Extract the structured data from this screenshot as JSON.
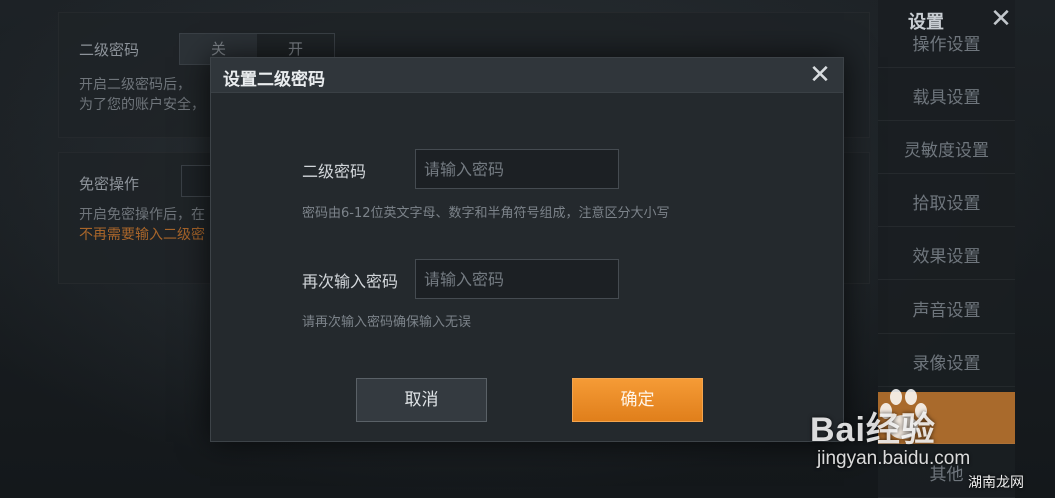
{
  "background": {
    "panel1": {
      "label": "二级密码",
      "toggle_off": "关",
      "toggle_on": "开",
      "note_line1": "开启二级密码后，",
      "note_line2": "为了您的账户安全，"
    },
    "panel2": {
      "label": "免密操作",
      "note_line1": "开启免密操作后，在",
      "note_line2": "不再需要输入二级密"
    }
  },
  "sidebar": {
    "title": "设置",
    "items": [
      {
        "label": "操作设置"
      },
      {
        "label": "载具设置"
      },
      {
        "label": "灵敏度设置"
      },
      {
        "label": "拾取设置"
      },
      {
        "label": "效果设置"
      },
      {
        "label": "声音设置"
      },
      {
        "label": "录像设置"
      },
      {
        "label": ""
      },
      {
        "label": "其他"
      }
    ]
  },
  "modal": {
    "title": "设置二级密码",
    "field1": {
      "label": "二级密码",
      "placeholder": "请输入密码",
      "value": ""
    },
    "hint1": "密码由6-12位英文字母、数字和半角符号组成，注意区分大小写",
    "field2": {
      "label": "再次输入密码",
      "placeholder": "请输入密码",
      "value": ""
    },
    "hint2": "请再次输入密码确保输入无误",
    "cancel_label": "取消",
    "confirm_label": "确定"
  },
  "watermark": {
    "brand": "Bai经验",
    "url": "jingyan.baidu.com",
    "corner": "湖南龙网"
  },
  "colors": {
    "accent": "#f0902a",
    "panel_bg": "#24292d"
  }
}
